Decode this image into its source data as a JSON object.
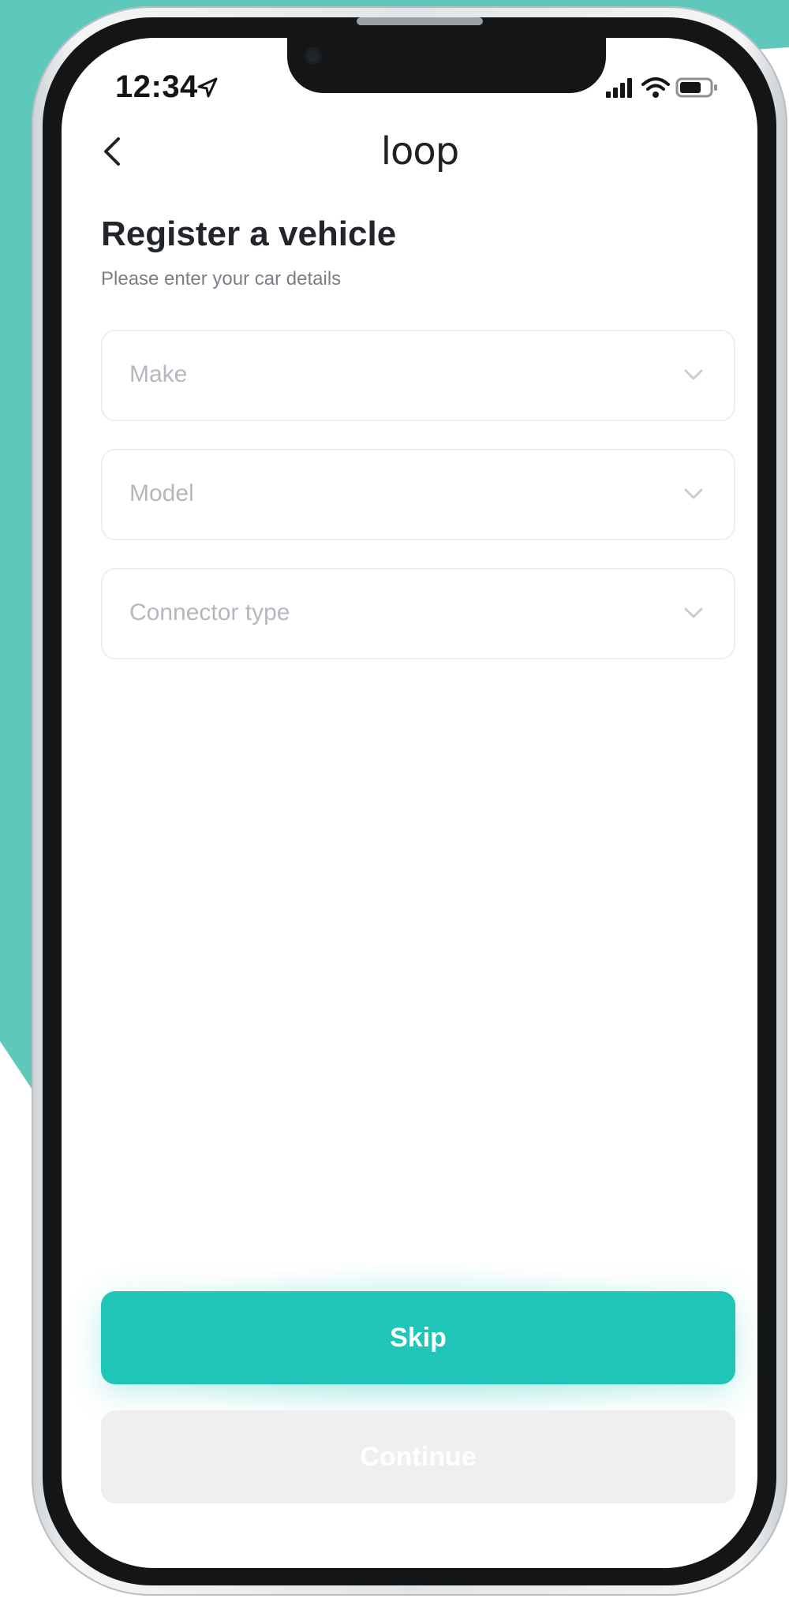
{
  "status_bar": {
    "time": "12:34"
  },
  "header": {
    "logo": "loop"
  },
  "page": {
    "title": "Register a vehicle",
    "subtitle": "Please enter your car details"
  },
  "form": {
    "fields": [
      {
        "placeholder": "Make"
      },
      {
        "placeholder": "Model"
      },
      {
        "placeholder": "Connector type"
      }
    ]
  },
  "actions": {
    "skip_label": "Skip",
    "continue_label": "Continue"
  },
  "theme": {
    "accent": "#1fc6b8",
    "background_accent": "#5ec9bb"
  },
  "icons": [
    "location-arrow-icon",
    "signal-icon",
    "wifi-icon",
    "battery-icon",
    "back-chevron-icon",
    "chevron-down-icon"
  ]
}
